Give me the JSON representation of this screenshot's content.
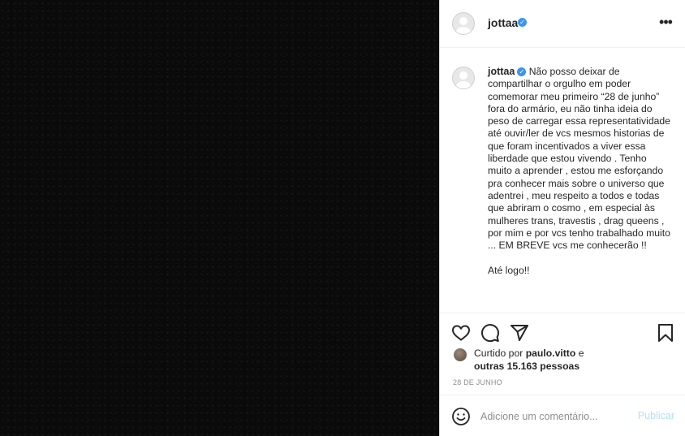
{
  "header": {
    "username": "jottaa",
    "more_icon": "more-horizontal-icon",
    "more_label": "•••"
  },
  "caption": {
    "username": "jottaa",
    "text": "Não posso deixar de compartilhar o orgulho em poder comemorar meu primeiro “28 de junho” fora do armário, eu não tinha ideia do peso de carregar essa representatividade até ouvir/ler de vcs mesmos historias de que foram incentivados a viver essa liberdade que estou vivendo . Tenho muito a aprender , estou me esforçando pra conhecer mais sobre o universo que adentrei , meu respeito a todos e todas que abriram o cosmo , em especial às mulheres trans, travestis , drag queens , por mim e por vcs tenho trabalhado muito ... EM BREVE vcs me conhecerão !!\n\nAté logo!!"
  },
  "actions": {
    "like_icon": "heart-icon",
    "comment_icon": "comment-icon",
    "share_icon": "send-icon",
    "save_icon": "bookmark-icon"
  },
  "likes": {
    "prefix": "Curtido por ",
    "liker": "paulo.vitto",
    "suffix": " e",
    "others": "outras 15.163 pessoas"
  },
  "date": "28 DE JUNHO",
  "comment": {
    "emoji_icon": "smiley-icon",
    "placeholder": "Adicione um comentário...",
    "post_label": "Publicar"
  },
  "colors": {
    "verified": "#3897f0",
    "post_button_disabled": "#b2dffc",
    "secondary_text": "#8e8e8e",
    "media_background": "#0a0a0a"
  }
}
